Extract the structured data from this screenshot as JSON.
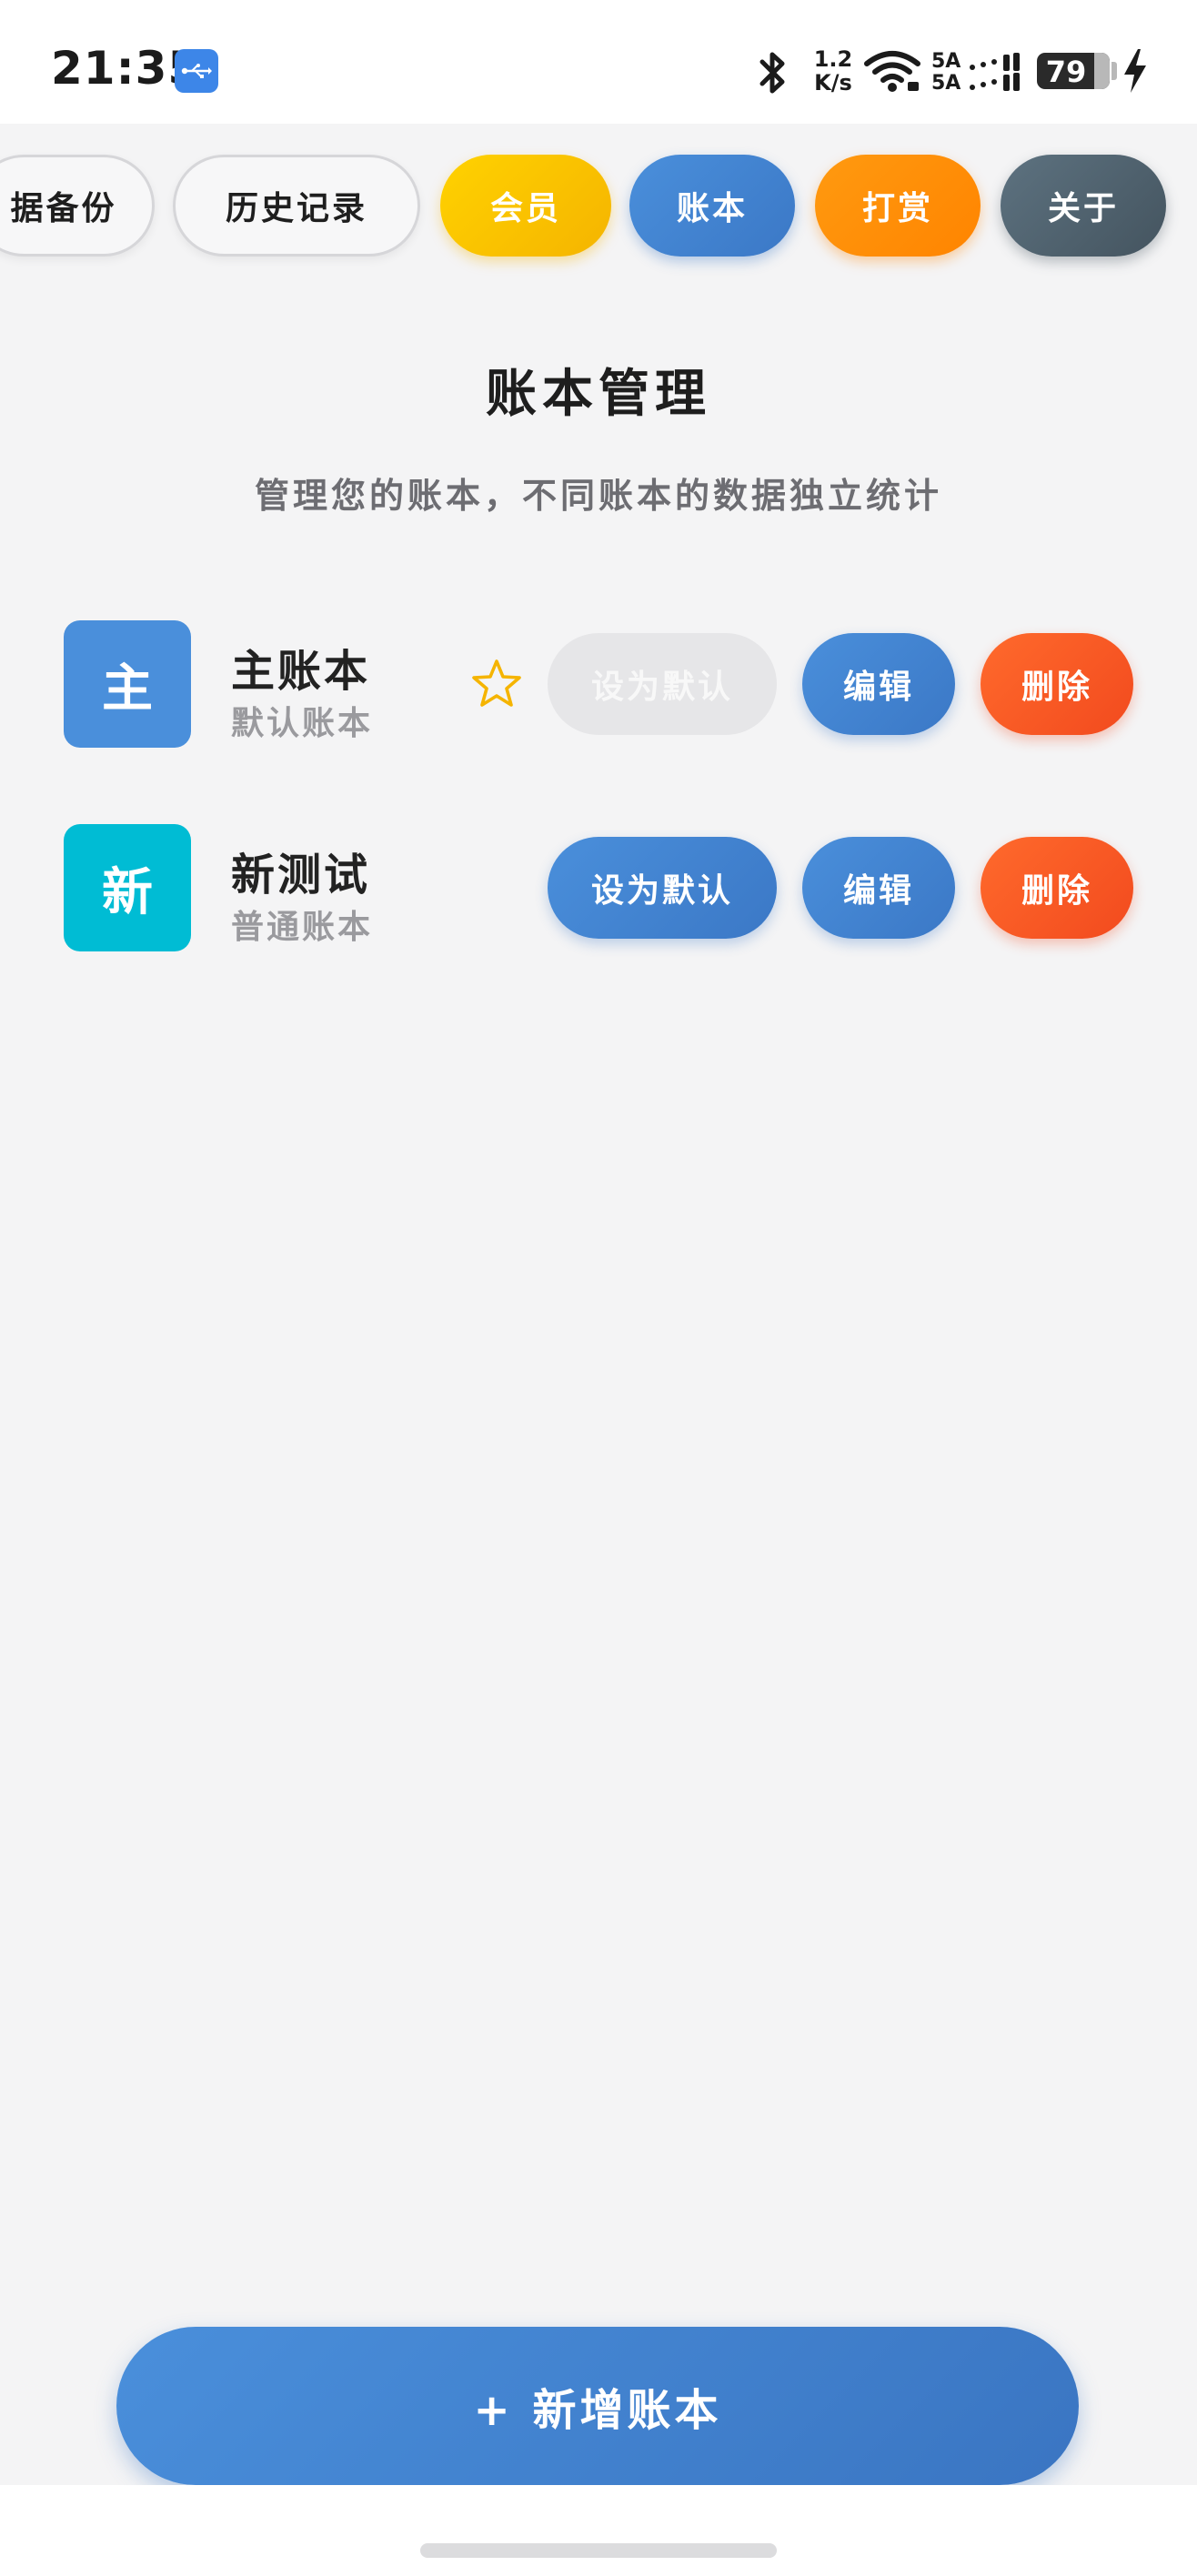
{
  "status_bar": {
    "time": "21:35",
    "usb_icon": "usb-icon",
    "net_speed_value": "1.2",
    "net_speed_unit": "K/s",
    "sim1_label": "5A",
    "sim2_label": "5A",
    "battery_level": "79",
    "battery_fraction": 0.79,
    "charging": true
  },
  "nav": {
    "chips": [
      {
        "id": "backup",
        "label": "据备份",
        "style": "outline"
      },
      {
        "id": "history",
        "label": "历史记录",
        "style": "outline"
      },
      {
        "id": "vip",
        "label": "会员",
        "style": "gold",
        "color": "#f5b400"
      },
      {
        "id": "ledger",
        "label": "账本",
        "style": "blue",
        "color": "#3b78c6"
      },
      {
        "id": "reward",
        "label": "打赏",
        "style": "orange",
        "color": "#ff8400"
      },
      {
        "id": "about",
        "label": "关于",
        "style": "slate",
        "color": "#44545f"
      }
    ]
  },
  "page": {
    "title": "账本管理",
    "subtitle": "管理您的账本，不同账本的数据独立统计"
  },
  "ledgers": [
    {
      "avatar_char": "主",
      "avatar_color": "#4a8fdb",
      "name": "主账本",
      "type": "默认账本",
      "is_default": true,
      "set_default_label": "设为默认",
      "edit_label": "编辑",
      "delete_label": "删除"
    },
    {
      "avatar_char": "新",
      "avatar_color": "#00bcd4",
      "name": "新测试",
      "type": "普通账本",
      "is_default": false,
      "set_default_label": "设为默认",
      "edit_label": "编辑",
      "delete_label": "删除"
    }
  ],
  "add_button": {
    "label": "+ 新增账本"
  },
  "colors": {
    "accent_blue": "#3b78c6",
    "danger": "#f24a1e",
    "star": "#f5b400"
  }
}
